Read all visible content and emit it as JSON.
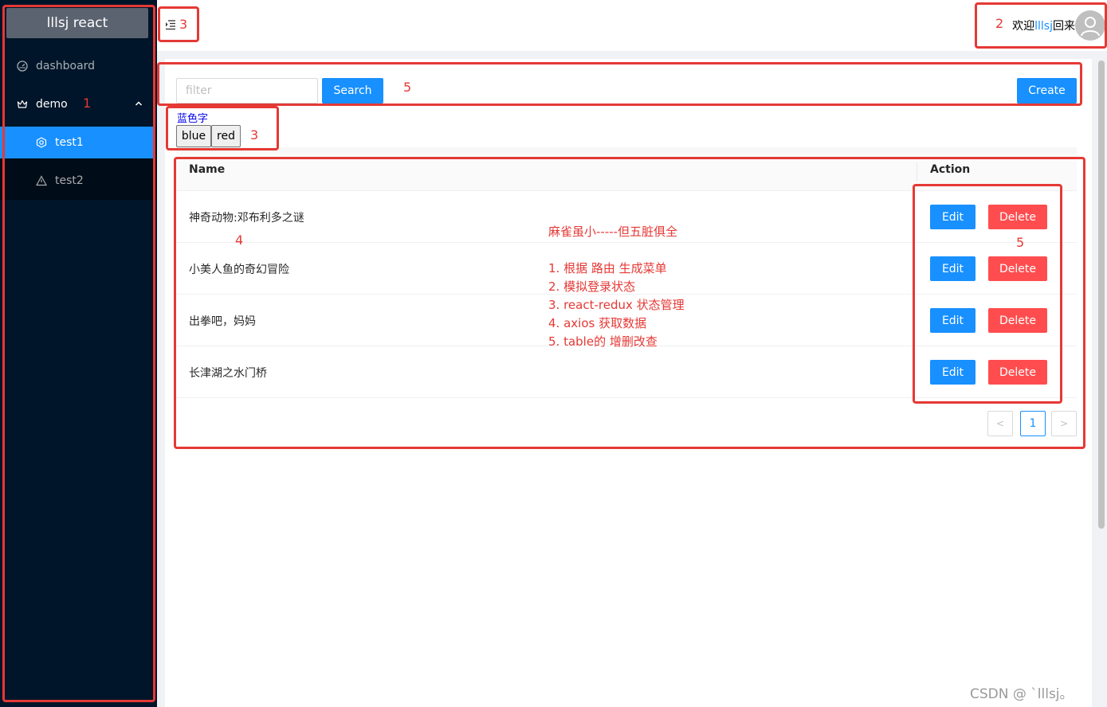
{
  "sidebar": {
    "logo": "lllsj react",
    "items": [
      {
        "label": "dashboard",
        "icon": "dashboard-icon"
      },
      {
        "label": "demo",
        "icon": "crown-icon"
      },
      {
        "label": "test1",
        "icon": "setting-icon"
      },
      {
        "label": "test2",
        "icon": "warning-icon"
      }
    ]
  },
  "header": {
    "welcome_prefix": "欢迎",
    "username": "lllsj",
    "welcome_suffix": "回来"
  },
  "toolbar": {
    "filter_placeholder": "filter",
    "search_label": "Search",
    "create_label": "Create"
  },
  "demo_area": {
    "blue_text": "蓝色字",
    "btn_blue": "blue",
    "btn_red": "red"
  },
  "table": {
    "columns": [
      "Name",
      "Action"
    ],
    "rows": [
      {
        "name": "神奇动物:邓布利多之谜",
        "edit": "Edit",
        "delete": "Delete"
      },
      {
        "name": "小美人鱼的奇幻冒险",
        "edit": "Edit",
        "delete": "Delete"
      },
      {
        "name": "出拳吧，妈妈",
        "edit": "Edit",
        "delete": "Delete"
      },
      {
        "name": "长津湖之水门桥",
        "edit": "Edit",
        "delete": "Delete"
      }
    ],
    "pagination": {
      "prev": "<",
      "current": "1",
      "next": ">"
    }
  },
  "annotations": {
    "labels": [
      "1",
      "2",
      "3",
      "3",
      "4",
      "5",
      "5"
    ],
    "notes": [
      "麻雀虽小-----但五脏俱全",
      "1. 根据 路由 生成菜单",
      "2. 模拟登录状态",
      "3. react-redux 状态管理",
      "4. axios 获取数据",
      "5. table的 增删改查"
    ]
  },
  "watermark": "CSDN @ `lllsj。",
  "colors": {
    "sider_bg": "#001529",
    "primary": "#1890ff",
    "danger": "#ff4d4f",
    "annotation": "#e53935"
  }
}
